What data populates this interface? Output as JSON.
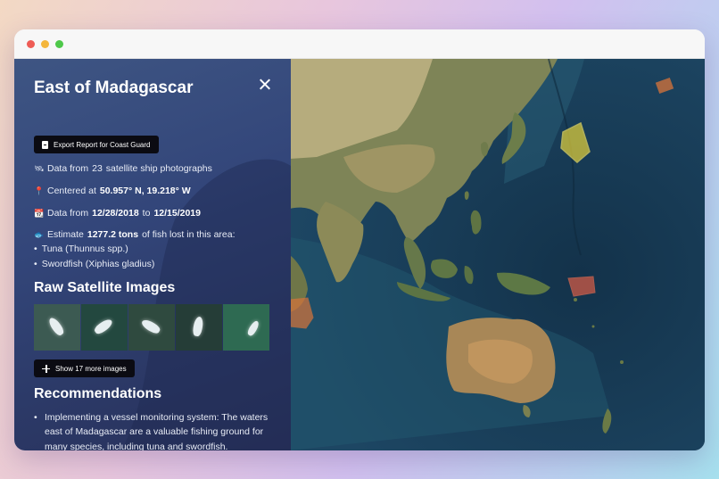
{
  "window": {
    "controls": [
      "close",
      "minimize",
      "maximize"
    ]
  },
  "panel": {
    "title": "East of Madagascar",
    "export_label": "Export Report for Coast Guard",
    "info": {
      "photos_prefix": "Data from",
      "photos_count": "23",
      "photos_suffix": "satellite ship photographs",
      "centered_prefix": "Centered at",
      "centered_value": "50.957° N, 19.218° W",
      "date_prefix": "Data from",
      "date_start": "12/28/2018",
      "date_joiner": "to",
      "date_end": "12/15/2019",
      "estimate_prefix": "Estimate",
      "estimate_value": "1277.2 tons",
      "estimate_suffix": "of fish lost in this area:"
    },
    "species": [
      "Tuna (Thunnus spp.)",
      "Swordfish (Xiphias gladius)"
    ],
    "raw_images_heading": "Raw Satellite Images",
    "thumbnails": [
      {
        "bg": "#3c5a52"
      },
      {
        "bg": "#23483f"
      },
      {
        "bg": "#2f4a3f"
      },
      {
        "bg": "#253d37"
      },
      {
        "bg": "#2e6a52"
      }
    ],
    "show_more_label": "Show 17 more images",
    "recommendations_heading": "Recommendations",
    "recommendation_text": "Implementing a vessel monitoring system: The waters east of Madagascar are a valuable fishing ground for many species, including tuna and swordfish. Implementing a vessel monitoring system could help to monitor fishing activities and ensure"
  },
  "map": {
    "ocean_color": "#1d4663",
    "land_color": "#6e7a4e",
    "highlight_colors": {
      "orange": "#d9743a",
      "yellow": "#e6d33a",
      "red": "#cf5a46"
    }
  },
  "icons": {
    "photos": "satellite-icon",
    "location": "pin-icon",
    "calendar": "calendar-icon",
    "fish": "fish-icon",
    "export": "document-icon",
    "show_more": "plus-icon",
    "close": "close-icon"
  }
}
